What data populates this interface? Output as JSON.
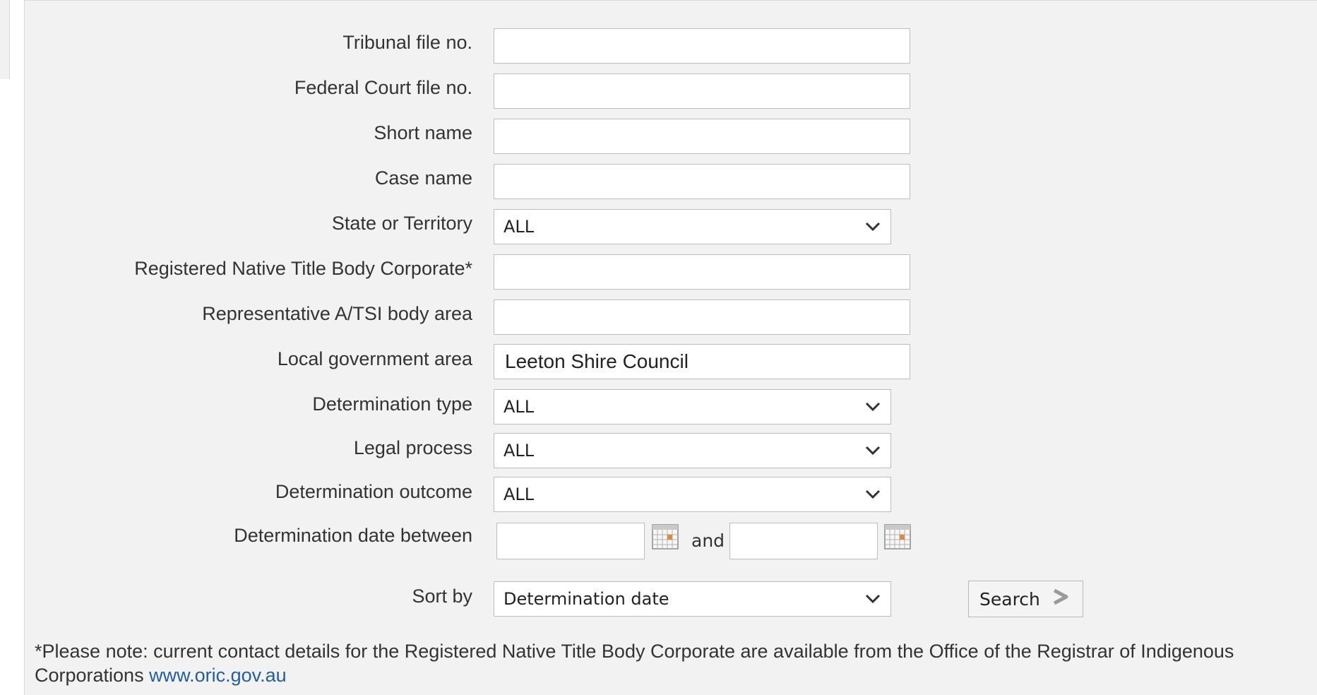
{
  "form": {
    "fields": [
      {
        "label": "Tribunal file no.",
        "type": "text",
        "value": ""
      },
      {
        "label": "Federal Court file no.",
        "type": "text",
        "value": ""
      },
      {
        "label": "Short name",
        "type": "text",
        "value": ""
      },
      {
        "label": "Case name",
        "type": "text",
        "value": ""
      },
      {
        "label": "State or Territory",
        "type": "select",
        "value": "ALL"
      },
      {
        "label": "Registered Native Title Body Corporate*",
        "type": "text",
        "value": ""
      },
      {
        "label": "Representative A/TSI body area",
        "type": "text",
        "value": ""
      },
      {
        "label": "Local government area",
        "type": "text",
        "value": "Leeton Shire Council"
      },
      {
        "label": "Determination type",
        "type": "select",
        "value": "ALL"
      },
      {
        "label": "Legal process",
        "type": "select",
        "value": "ALL"
      },
      {
        "label": "Determination outcome",
        "type": "select",
        "value": "ALL"
      }
    ],
    "date_range": {
      "label": "Determination date between",
      "connector": "and",
      "from_value": "",
      "to_value": ""
    },
    "sort": {
      "label": "Sort by",
      "value": "Determination date"
    },
    "search_button_label": "Search"
  },
  "note": {
    "text": "*Please note: current contact details for the Registered Native Title Body Corporate are available from the Office of the Registrar of Indigenous Corporations",
    "link_text": "www.oric.gov.au"
  },
  "icons": {
    "select_arrow": "chevron-down-icon",
    "date_picker": "calendar-icon",
    "search_arrow": "chevron-right-icon"
  },
  "colors": {
    "panel_background": "#f2f2f2",
    "link": "#1f5fa6",
    "input_border": "#bdbdbd"
  }
}
